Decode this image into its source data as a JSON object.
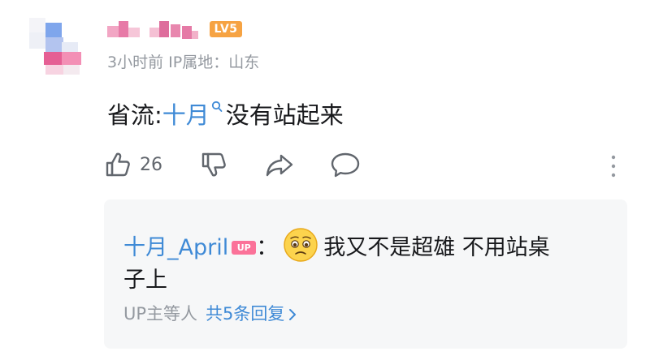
{
  "comment": {
    "level_badge": "LV5",
    "time": "3小时前",
    "ip_location": "IP属地：山东",
    "text_prefix": "省流:",
    "link_text": "十月",
    "text_suffix": "没有站起来",
    "like_count": "26"
  },
  "icons": {
    "like": "thumbs-up-icon",
    "dislike": "thumbs-down-icon",
    "share": "share-icon",
    "reply": "comment-icon",
    "more": "more-vertical-icon",
    "search": "search-icon"
  },
  "reply": {
    "author": "十月_April",
    "up_badge": "UP",
    "colon": "：",
    "emoji": "pleading-face-emoji",
    "text_line1": "我又不是超雄 不用站桌",
    "text_line2": "子上",
    "footer_prefix": "UP主等人",
    "footer_total": "共5条回复"
  },
  "colors": {
    "link": "#3f8ad6",
    "secondary_text": "#9499a0",
    "level_badge": "#f6a343",
    "up_badge": "#fb7299",
    "reply_bg": "#f6f7f8"
  }
}
